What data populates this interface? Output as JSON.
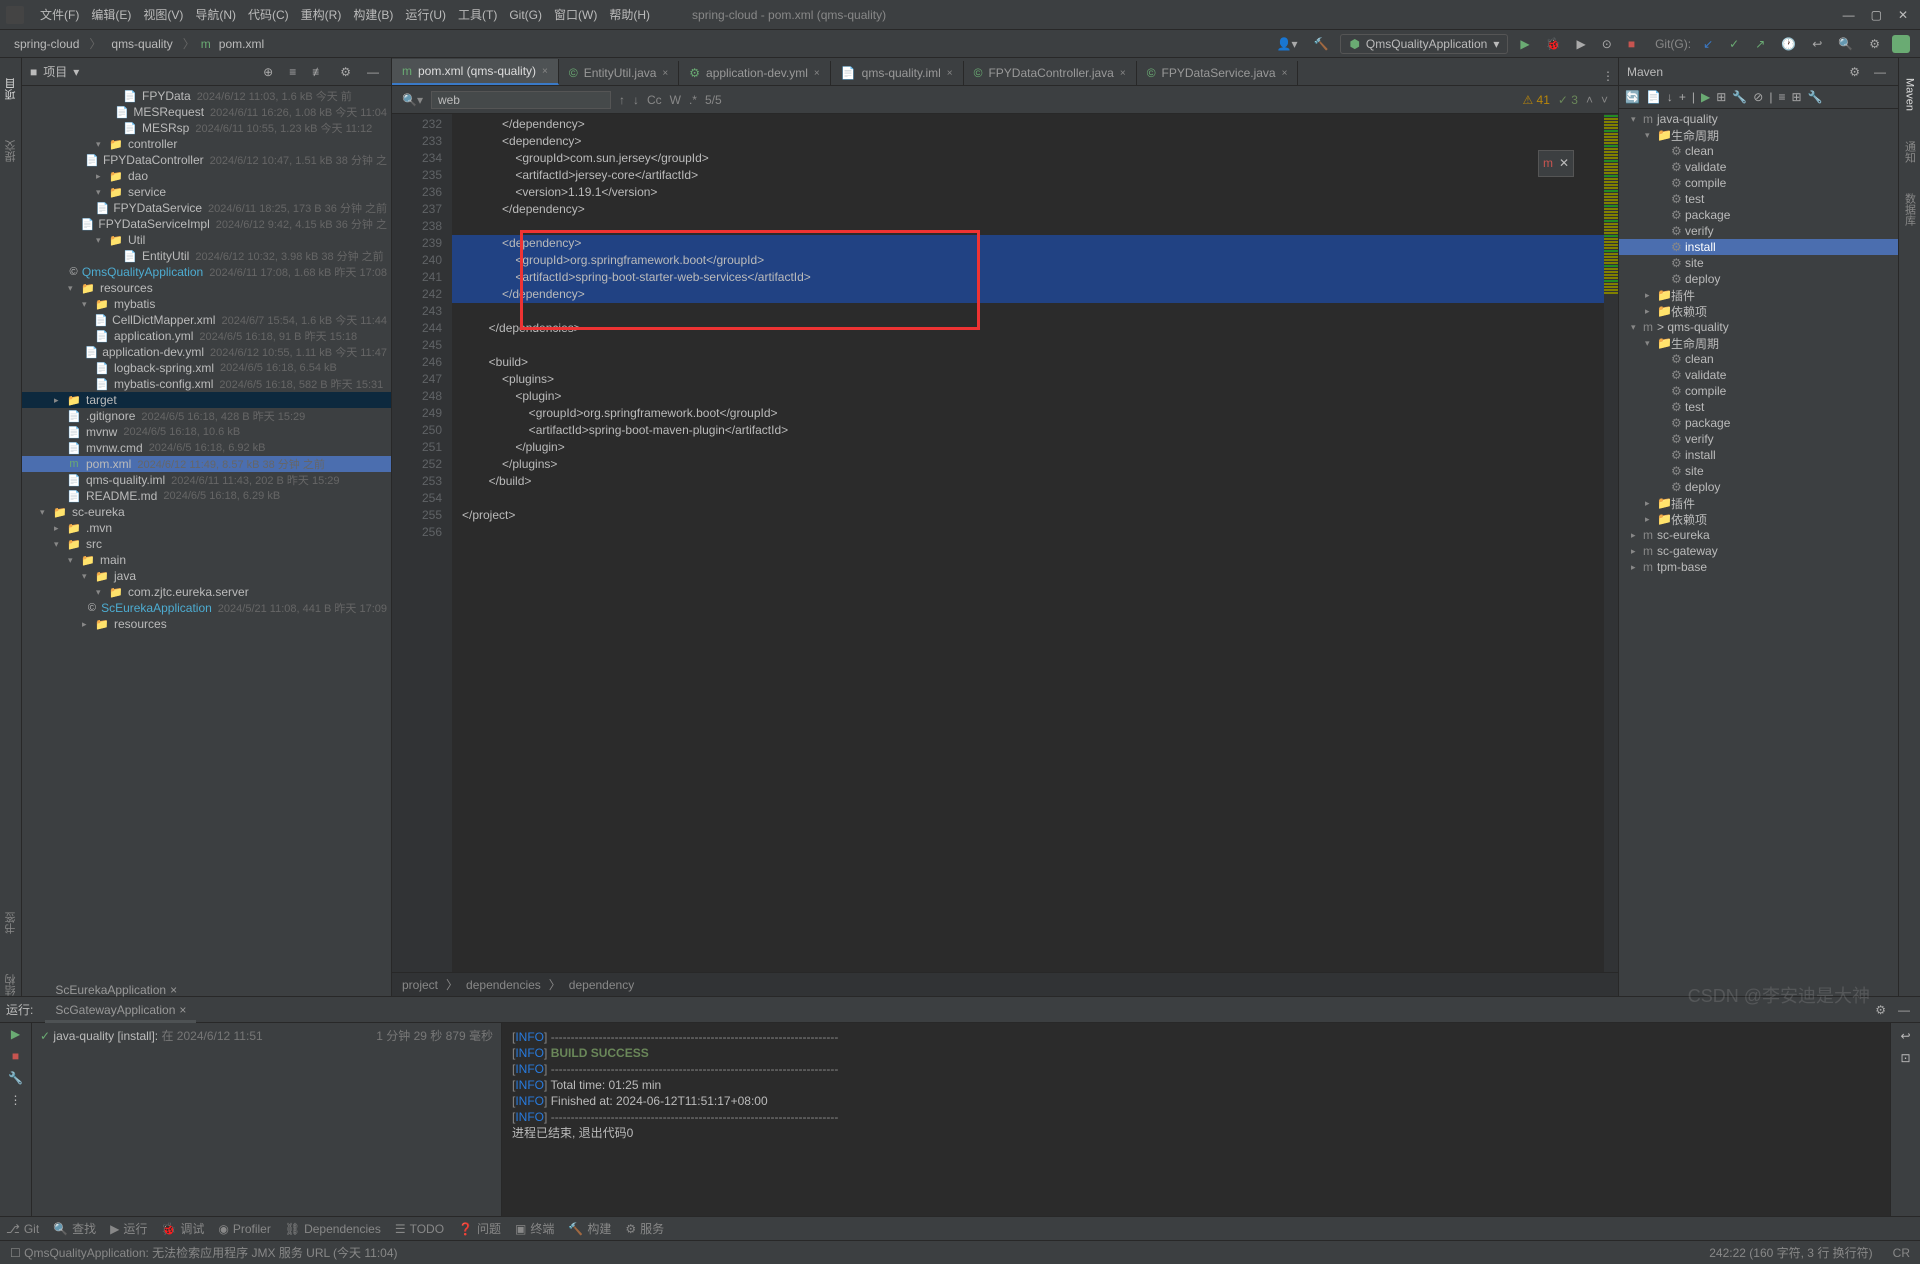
{
  "window": {
    "title": "spring-cloud - pom.xml (qms-quality)"
  },
  "menubar": [
    "文件(F)",
    "编辑(E)",
    "视图(V)",
    "导航(N)",
    "代码(C)",
    "重构(R)",
    "构建(B)",
    "运行(U)",
    "工具(T)",
    "Git(G)",
    "窗口(W)",
    "帮助(H)"
  ],
  "breadcrumb": [
    "spring-cloud",
    "qms-quality",
    "pom.xml"
  ],
  "runConfig": "QmsQualityApplication",
  "gitLabel": "Git(G):",
  "projectPanel": {
    "title": "项目"
  },
  "projectTree": [
    {
      "indent": 6,
      "arrow": "",
      "icon": "📄",
      "iconClass": "file-java",
      "label": "FPYData",
      "meta": "2024/6/12 11:03, 1.6 kB  今天 前"
    },
    {
      "indent": 6,
      "arrow": "",
      "icon": "📄",
      "iconClass": "file-java",
      "label": "MESRequest",
      "meta": "2024/6/11 16:26, 1.08 kB  今天 11:04"
    },
    {
      "indent": 6,
      "arrow": "",
      "icon": "📄",
      "iconClass": "file-java",
      "label": "MESRsp",
      "meta": "2024/6/11 10:55, 1.23 kB  今天 11:12"
    },
    {
      "indent": 5,
      "arrow": "▾",
      "icon": "📁",
      "iconClass": "folder",
      "label": "controller",
      "meta": ""
    },
    {
      "indent": 6,
      "arrow": "",
      "icon": "📄",
      "iconClass": "file-java",
      "label": "FPYDataController",
      "meta": "2024/6/12 10:47, 1.51 kB  38 分钟 之"
    },
    {
      "indent": 5,
      "arrow": "▸",
      "icon": "📁",
      "iconClass": "folder",
      "label": "dao",
      "meta": ""
    },
    {
      "indent": 5,
      "arrow": "▾",
      "icon": "📁",
      "iconClass": "folder",
      "label": "service",
      "meta": ""
    },
    {
      "indent": 6,
      "arrow": "",
      "icon": "📄",
      "iconClass": "file-java",
      "label": "FPYDataService",
      "meta": "2024/6/11 18:25, 173 B  36 分钟 之前"
    },
    {
      "indent": 6,
      "arrow": "",
      "icon": "📄",
      "iconClass": "file-java",
      "label": "FPYDataServiceImpl",
      "meta": "2024/6/12 9:42, 4.15 kB  36 分钟 之"
    },
    {
      "indent": 5,
      "arrow": "▾",
      "icon": "📁",
      "iconClass": "folder",
      "label": "Util",
      "meta": ""
    },
    {
      "indent": 6,
      "arrow": "",
      "icon": "📄",
      "iconClass": "file-java",
      "label": "EntityUtil",
      "meta": "2024/6/12 10:32, 3.98 kB  38 分钟 之前"
    },
    {
      "indent": 5,
      "arrow": "",
      "icon": "©",
      "iconClass": "",
      "label": "QmsQualityApplication",
      "meta": "2024/6/11 17:08, 1.68 kB  昨天 17:08",
      "color": "#4dacd1"
    },
    {
      "indent": 3,
      "arrow": "▾",
      "icon": "📁",
      "iconClass": "folder",
      "label": "resources",
      "meta": ""
    },
    {
      "indent": 4,
      "arrow": "▾",
      "icon": "📁",
      "iconClass": "folder",
      "label": "mybatis",
      "meta": ""
    },
    {
      "indent": 5,
      "arrow": "",
      "icon": "📄",
      "iconClass": "file-xml",
      "label": "CellDictMapper.xml",
      "meta": "2024/6/7 15:54, 1.6 kB  今天 11:44"
    },
    {
      "indent": 4,
      "arrow": "",
      "icon": "📄",
      "iconClass": "file-yml",
      "label": "application.yml",
      "meta": "2024/6/5 16:18, 91 B  昨天 15:18"
    },
    {
      "indent": 4,
      "arrow": "",
      "icon": "📄",
      "iconClass": "file-yml",
      "label": "application-dev.yml",
      "meta": "2024/6/12 10:55, 1.11 kB  今天 11:47"
    },
    {
      "indent": 4,
      "arrow": "",
      "icon": "📄",
      "iconClass": "file-xml",
      "label": "logback-spring.xml",
      "meta": "2024/6/5 16:18, 6.54 kB"
    },
    {
      "indent": 4,
      "arrow": "",
      "icon": "📄",
      "iconClass": "file-xml",
      "label": "mybatis-config.xml",
      "meta": "2024/6/5 16:18, 582 B  昨天 15:31"
    },
    {
      "indent": 2,
      "arrow": "▸",
      "icon": "📁",
      "iconClass": "folder",
      "label": "target",
      "meta": "",
      "selected": true
    },
    {
      "indent": 2,
      "arrow": "",
      "icon": "📄",
      "iconClass": "",
      "label": ".gitignore",
      "meta": "2024/6/5 16:18, 428 B  昨天 15:29"
    },
    {
      "indent": 2,
      "arrow": "",
      "icon": "📄",
      "iconClass": "",
      "label": "mvnw",
      "meta": "2024/6/5 16:18, 10.6 kB"
    },
    {
      "indent": 2,
      "arrow": "",
      "icon": "📄",
      "iconClass": "",
      "label": "mvnw.cmd",
      "meta": "2024/6/5 16:18, 6.92 kB"
    },
    {
      "indent": 2,
      "arrow": "",
      "icon": "m",
      "iconClass": "",
      "label": "pom.xml",
      "meta": "2024/6/12 11:49, 8.57 kB  38 分钟 之前",
      "highlighted": true,
      "iconColor": "#6aab73"
    },
    {
      "indent": 2,
      "arrow": "",
      "icon": "📄",
      "iconClass": "file-xml",
      "label": "qms-quality.iml",
      "meta": "2024/6/11 11:43, 202 B  昨天 15:29"
    },
    {
      "indent": 2,
      "arrow": "",
      "icon": "📄",
      "iconClass": "",
      "label": "README.md",
      "meta": "2024/6/5 16:18, 6.29 kB"
    },
    {
      "indent": 1,
      "arrow": "▾",
      "icon": "📁",
      "iconClass": "folder",
      "label": "sc-eureka",
      "meta": ""
    },
    {
      "indent": 2,
      "arrow": "▸",
      "icon": "📁",
      "iconClass": "folder",
      "label": ".mvn",
      "meta": ""
    },
    {
      "indent": 2,
      "arrow": "▾",
      "icon": "📁",
      "iconClass": "folder",
      "label": "src",
      "meta": ""
    },
    {
      "indent": 3,
      "arrow": "▾",
      "icon": "📁",
      "iconClass": "folder",
      "label": "main",
      "meta": ""
    },
    {
      "indent": 4,
      "arrow": "▾",
      "icon": "📁",
      "iconClass": "folder",
      "label": "java",
      "meta": ""
    },
    {
      "indent": 5,
      "arrow": "▾",
      "icon": "📁",
      "iconClass": "folder",
      "label": "com.zjtc.eureka.server",
      "meta": ""
    },
    {
      "indent": 6,
      "arrow": "",
      "icon": "©",
      "iconClass": "",
      "label": "ScEurekaApplication",
      "meta": "2024/5/21 11:08, 441 B  昨天 17:09",
      "color": "#4dacd1"
    },
    {
      "indent": 4,
      "arrow": "▸",
      "icon": "📁",
      "iconClass": "folder",
      "label": "resources",
      "meta": ""
    }
  ],
  "tabs": [
    {
      "label": "pom.xml (qms-quality)",
      "active": true,
      "icon": "m"
    },
    {
      "label": "EntityUtil.java",
      "icon": "©"
    },
    {
      "label": "application-dev.yml",
      "icon": "⚙"
    },
    {
      "label": "qms-quality.iml",
      "icon": "📄"
    },
    {
      "label": "FPYDataController.java",
      "icon": "©"
    },
    {
      "label": "FPYDataService.java",
      "icon": "©"
    }
  ],
  "search": {
    "value": "web",
    "matchCount": "5/5"
  },
  "editor": {
    "startLine": 232,
    "lines": [
      {
        "text": "            </dependency>",
        "sel": false
      },
      {
        "text": "            <dependency>",
        "sel": false
      },
      {
        "text": "                <groupId>com.sun.jersey</groupId>",
        "sel": false
      },
      {
        "text": "                <artifactId>jersey-core</artifactId>",
        "sel": false
      },
      {
        "text": "                <version>1.19.1</version>",
        "sel": false
      },
      {
        "text": "            </dependency>",
        "sel": false
      },
      {
        "text": "",
        "sel": false
      },
      {
        "text": "            <dependency>",
        "sel": true
      },
      {
        "text": "                <groupId>org.springframework.boot</groupId>",
        "sel": true
      },
      {
        "text": "                <artifactId>spring-boot-starter-web-services</artifactId>",
        "sel": true
      },
      {
        "text": "            </dependency>",
        "sel": true
      },
      {
        "text": "",
        "sel": false
      },
      {
        "text": "        </dependencies>",
        "sel": false
      },
      {
        "text": "",
        "sel": false
      },
      {
        "text": "        <build>",
        "sel": false
      },
      {
        "text": "            <plugins>",
        "sel": false
      },
      {
        "text": "                <plugin>",
        "sel": false
      },
      {
        "text": "                    <groupId>org.springframework.boot</groupId>",
        "sel": false
      },
      {
        "text": "                    <artifactId>spring-boot-maven-plugin</artifactId>",
        "sel": false
      },
      {
        "text": "                </plugin>",
        "sel": false
      },
      {
        "text": "            </plugins>",
        "sel": false
      },
      {
        "text": "        </build>",
        "sel": false
      },
      {
        "text": "",
        "sel": false
      },
      {
        "text": "</project>",
        "sel": false
      },
      {
        "text": "",
        "sel": false
      }
    ],
    "warnings": "41",
    "greenChecks": "3"
  },
  "editorBreadcrumb": [
    "project",
    "dependencies",
    "dependency"
  ],
  "maven": {
    "title": "Maven",
    "tree": [
      {
        "indent": 0,
        "arrow": "▾",
        "label": "java-quality",
        "icon": "m"
      },
      {
        "indent": 1,
        "arrow": "▾",
        "label": "生命周期",
        "icon": "📁"
      },
      {
        "indent": 2,
        "arrow": "",
        "label": "clean",
        "icon": "⚙"
      },
      {
        "indent": 2,
        "arrow": "",
        "label": "validate",
        "icon": "⚙"
      },
      {
        "indent": 2,
        "arrow": "",
        "label": "compile",
        "icon": "⚙"
      },
      {
        "indent": 2,
        "arrow": "",
        "label": "test",
        "icon": "⚙"
      },
      {
        "indent": 2,
        "arrow": "",
        "label": "package",
        "icon": "⚙"
      },
      {
        "indent": 2,
        "arrow": "",
        "label": "verify",
        "icon": "⚙"
      },
      {
        "indent": 2,
        "arrow": "",
        "label": "install",
        "icon": "⚙",
        "selected": true
      },
      {
        "indent": 2,
        "arrow": "",
        "label": "site",
        "icon": "⚙"
      },
      {
        "indent": 2,
        "arrow": "",
        "label": "deploy",
        "icon": "⚙"
      },
      {
        "indent": 1,
        "arrow": "▸",
        "label": "插件",
        "icon": "📁"
      },
      {
        "indent": 1,
        "arrow": "▸",
        "label": "依赖项",
        "icon": "📁"
      },
      {
        "indent": 0,
        "arrow": "▾",
        "label": "> qms-quality",
        "icon": "m"
      },
      {
        "indent": 1,
        "arrow": "▾",
        "label": "生命周期",
        "icon": "📁"
      },
      {
        "indent": 2,
        "arrow": "",
        "label": "clean",
        "icon": "⚙"
      },
      {
        "indent": 2,
        "arrow": "",
        "label": "validate",
        "icon": "⚙"
      },
      {
        "indent": 2,
        "arrow": "",
        "label": "compile",
        "icon": "⚙"
      },
      {
        "indent": 2,
        "arrow": "",
        "label": "test",
        "icon": "⚙"
      },
      {
        "indent": 2,
        "arrow": "",
        "label": "package",
        "icon": "⚙"
      },
      {
        "indent": 2,
        "arrow": "",
        "label": "verify",
        "icon": "⚙"
      },
      {
        "indent": 2,
        "arrow": "",
        "label": "install",
        "icon": "⚙"
      },
      {
        "indent": 2,
        "arrow": "",
        "label": "site",
        "icon": "⚙"
      },
      {
        "indent": 2,
        "arrow": "",
        "label": "deploy",
        "icon": "⚙"
      },
      {
        "indent": 1,
        "arrow": "▸",
        "label": "插件",
        "icon": "📁"
      },
      {
        "indent": 1,
        "arrow": "▸",
        "label": "依赖项",
        "icon": "📁"
      },
      {
        "indent": 0,
        "arrow": "▸",
        "label": "sc-eureka",
        "icon": "m"
      },
      {
        "indent": 0,
        "arrow": "▸",
        "label": "sc-gateway",
        "icon": "m"
      },
      {
        "indent": 0,
        "arrow": "▸",
        "label": "tpm-base",
        "icon": "m"
      }
    ]
  },
  "runPanel": {
    "label": "运行:",
    "tabs": [
      {
        "label": "ScEurekaApplication"
      },
      {
        "label": "ScGatewayApplication"
      },
      {
        "label": "java-quality [install]",
        "active": true,
        "icon": "m"
      }
    ],
    "taskLabel": "java-quality [install]:",
    "taskTime": "在 2024/6/12 11:51",
    "elapsed": "1 分钟 29 秒 879 毫秒",
    "console": [
      {
        "level": "[INFO]",
        "text": " ------------------------------------------------------------------------",
        "type": "dash"
      },
      {
        "level": "[INFO]",
        "text": " BUILD SUCCESS",
        "type": "success"
      },
      {
        "level": "[INFO]",
        "text": " ------------------------------------------------------------------------",
        "type": "dash"
      },
      {
        "level": "[INFO]",
        "text": " Total time:  01:25 min"
      },
      {
        "level": "[INFO]",
        "text": " Finished at: 2024-06-12T11:51:17+08:00"
      },
      {
        "level": "[INFO]",
        "text": " ------------------------------------------------------------------------",
        "type": "dash"
      },
      {
        "level": "",
        "text": ""
      },
      {
        "level": "",
        "text": "进程已结束, 退出代码0"
      }
    ]
  },
  "bottomBar": [
    "Git",
    "查找",
    "运行",
    "调试",
    "Profiler",
    "Dependencies",
    "TODO",
    "问题",
    "终端",
    "构建",
    "服务"
  ],
  "statusMsg": "QmsQualityApplication: 无法检索应用程序 JMX 服务 URL (今天 11:04)",
  "statusRight": {
    "pos": "242:22 (160 字符, 3 行 换行符)",
    "enc": "CR"
  },
  "watermark": "CSDN @李安迪是大神",
  "leftStripe": [
    "项目",
    "提交",
    "书签",
    "结构"
  ],
  "rightStripe": [
    "Maven",
    "通知",
    "数据库"
  ]
}
